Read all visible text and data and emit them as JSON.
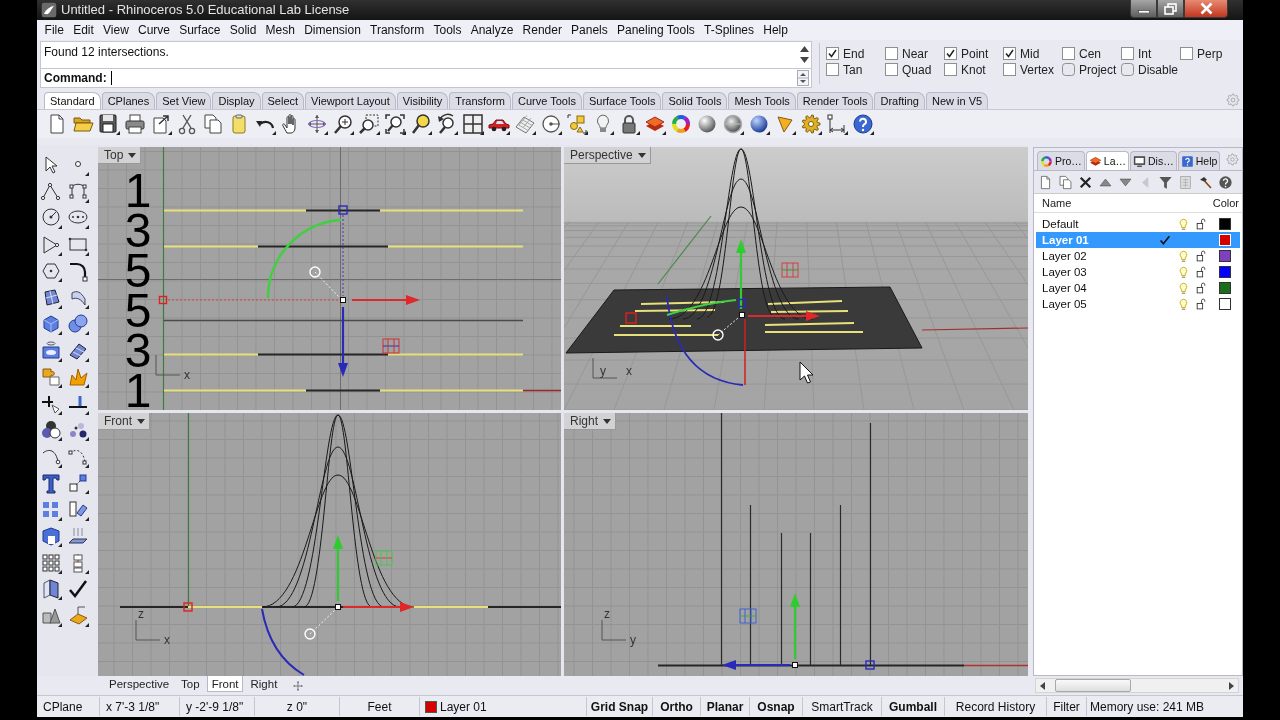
{
  "window": {
    "title": "Untitled - Rhinoceros 5.0 Educational Lab License"
  },
  "menu": [
    "File",
    "Edit",
    "View",
    "Curve",
    "Surface",
    "Solid",
    "Mesh",
    "Dimension",
    "Transform",
    "Tools",
    "Analyze",
    "Render",
    "Panels",
    "Paneling Tools",
    "T-Splines",
    "Help"
  ],
  "command": {
    "history": "Found 12 intersections.",
    "prompt": "Command:"
  },
  "osnaps": [
    {
      "label": "End",
      "checked": true,
      "kind": "snap"
    },
    {
      "label": "Near",
      "checked": false,
      "kind": "snap"
    },
    {
      "label": "Point",
      "checked": true,
      "kind": "snap"
    },
    {
      "label": "Mid",
      "checked": true,
      "kind": "snap"
    },
    {
      "label": "Cen",
      "checked": false,
      "kind": "snap"
    },
    {
      "label": "Int",
      "checked": false,
      "kind": "snap"
    },
    {
      "label": "Perp",
      "checked": false,
      "kind": "snap"
    },
    {
      "label": "Tan",
      "checked": false,
      "kind": "snap"
    },
    {
      "label": "Quad",
      "checked": false,
      "kind": "snap"
    },
    {
      "label": "Knot",
      "checked": false,
      "kind": "snap"
    },
    {
      "label": "Vertex",
      "checked": false,
      "kind": "snap"
    },
    {
      "label": "Project",
      "checked": false,
      "kind": "toggle"
    },
    {
      "label": "Disable",
      "checked": false,
      "kind": "toggle"
    }
  ],
  "toolbar_tabs": [
    {
      "label": "Standard",
      "selected": true
    },
    {
      "label": "CPlanes",
      "selected": false
    },
    {
      "label": "Set View",
      "selected": false
    },
    {
      "label": "Display",
      "selected": false
    },
    {
      "label": "Select",
      "selected": false
    },
    {
      "label": "Viewport Layout",
      "selected": false
    },
    {
      "label": "Visibility",
      "selected": false
    },
    {
      "label": "Transform",
      "selected": false
    },
    {
      "label": "Curve Tools",
      "selected": false
    },
    {
      "label": "Surface Tools",
      "selected": false
    },
    {
      "label": "Solid Tools",
      "selected": false
    },
    {
      "label": "Mesh Tools",
      "selected": false
    },
    {
      "label": "Render Tools",
      "selected": false
    },
    {
      "label": "Drafting",
      "selected": false
    },
    {
      "label": "New in V5",
      "selected": false
    }
  ],
  "viewports": [
    {
      "title": "Top",
      "kind": "top",
      "numerals": [
        "1",
        "3",
        "5",
        "5",
        "3",
        "1"
      ],
      "axis_labels": [
        "x"
      ]
    },
    {
      "title": "Perspective",
      "kind": "perspective",
      "axis_labels": [
        "y",
        "x"
      ]
    },
    {
      "title": "Front",
      "kind": "front",
      "axis_labels": [
        "z",
        "x"
      ]
    },
    {
      "title": "Right",
      "kind": "right",
      "axis_labels": [
        "z",
        "y"
      ]
    }
  ],
  "viewport_tabs": [
    {
      "label": "Perspective",
      "selected": false
    },
    {
      "label": "Top",
      "selected": false
    },
    {
      "label": "Front",
      "selected": true
    },
    {
      "label": "Right",
      "selected": false
    }
  ],
  "panel": {
    "tabs": [
      {
        "label": "Pro…",
        "kind": "properties",
        "selected": false
      },
      {
        "label": "La…",
        "kind": "layers",
        "selected": true
      },
      {
        "label": "Dis…",
        "kind": "display",
        "selected": false
      },
      {
        "label": "Help",
        "kind": "help",
        "selected": false
      }
    ],
    "columns": [
      "Name",
      "Color"
    ],
    "layers": [
      {
        "name": "Default",
        "current": false,
        "selected": false,
        "color": "#000000"
      },
      {
        "name": "Layer 01",
        "current": true,
        "selected": true,
        "color": "#d40000"
      },
      {
        "name": "Layer 02",
        "current": false,
        "selected": false,
        "color": "#7f3fbf"
      },
      {
        "name": "Layer 03",
        "current": false,
        "selected": false,
        "color": "#0000ff"
      },
      {
        "name": "Layer 04",
        "current": false,
        "selected": false,
        "color": "#1b6e1b"
      },
      {
        "name": "Layer 05",
        "current": false,
        "selected": false,
        "color": "#ffffff"
      }
    ]
  },
  "status_bar": {
    "cplane": "CPlane",
    "x": "x 7'-3 1/8\"",
    "y": "y -2'-9 1/8\"",
    "z": "z 0\"",
    "units": "Feet",
    "layer": {
      "name": "Layer 01",
      "color": "#d40000"
    },
    "toggles": [
      {
        "label": "Grid Snap",
        "on": true
      },
      {
        "label": "Ortho",
        "on": true
      },
      {
        "label": "Planar",
        "on": true
      },
      {
        "label": "Osnap",
        "on": true
      },
      {
        "label": "SmartTrack",
        "on": false
      },
      {
        "label": "Gumball",
        "on": true
      },
      {
        "label": "Record History",
        "on": false
      },
      {
        "label": "Filter",
        "on": false
      }
    ],
    "memory": "Memory use: 241 MB"
  }
}
